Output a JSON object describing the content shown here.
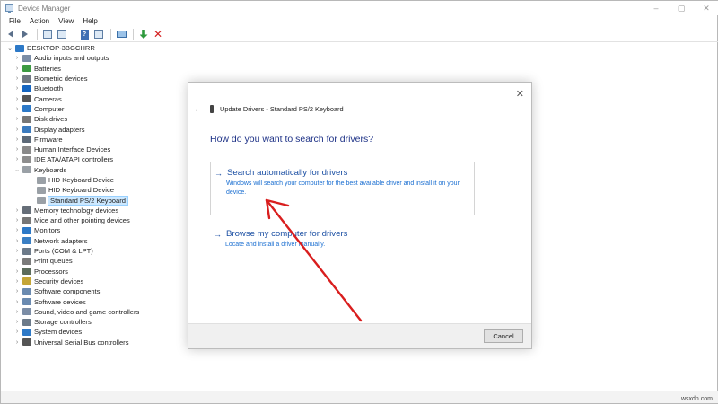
{
  "window": {
    "title": "Device Manager"
  },
  "titlebar": {
    "minimize": "–",
    "restore": "▢",
    "close": "✕"
  },
  "menu": [
    "File",
    "Action",
    "View",
    "Help"
  ],
  "toolbar": {
    "icons": [
      "back-icon",
      "forward-icon",
      "show-hide-tree-icon",
      "properties-icon",
      "help-icon",
      "scan-hardware-icon",
      "update-driver-icon",
      "uninstall-icon"
    ],
    "properties_glyph": "?"
  },
  "tree": {
    "root": "DESKTOP-3BGCHRR",
    "items": [
      {
        "label": "Audio inputs and outputs",
        "color": "#7b8da6",
        "expanded": false
      },
      {
        "label": "Batteries",
        "color": "#3c9a42",
        "expanded": false
      },
      {
        "label": "Biometric devices",
        "color": "#6f7782",
        "expanded": false
      },
      {
        "label": "Bluetooth",
        "color": "#1565c0",
        "expanded": false
      },
      {
        "label": "Cameras",
        "color": "#555555",
        "expanded": false
      },
      {
        "label": "Computer",
        "color": "#2d79c7",
        "expanded": false
      },
      {
        "label": "Disk drives",
        "color": "#777777",
        "expanded": false
      },
      {
        "label": "Display adapters",
        "color": "#3b7bbf",
        "expanded": false
      },
      {
        "label": "Firmware",
        "color": "#5d6a78",
        "expanded": false
      },
      {
        "label": "Human Interface Devices",
        "color": "#8a8a8a",
        "expanded": false
      },
      {
        "label": "IDE ATA/ATAPI controllers",
        "color": "#8e8e8e",
        "expanded": false
      },
      {
        "label": "Keyboards",
        "color": "#9aa0a6",
        "expanded": true
      },
      {
        "label": "HID Keyboard Device",
        "color": "#9aa0a6",
        "child": true
      },
      {
        "label": "HID Keyboard Device",
        "color": "#9aa0a6",
        "child": true
      },
      {
        "label": "Standard PS/2 Keyboard",
        "color": "#9aa0a6",
        "child": true,
        "selected": true
      },
      {
        "label": "Memory technology devices",
        "color": "#666e78",
        "expanded": false
      },
      {
        "label": "Mice and other pointing devices",
        "color": "#777777",
        "expanded": false
      },
      {
        "label": "Monitors",
        "color": "#2d79c7",
        "expanded": false
      },
      {
        "label": "Network adapters",
        "color": "#3a7fc4",
        "expanded": false
      },
      {
        "label": "Ports (COM & LPT)",
        "color": "#6c7a89",
        "expanded": false
      },
      {
        "label": "Print queues",
        "color": "#7a7a7a",
        "expanded": false
      },
      {
        "label": "Processors",
        "color": "#5b6b5b",
        "expanded": false
      },
      {
        "label": "Security devices",
        "color": "#c4a537",
        "expanded": false
      },
      {
        "label": "Software components",
        "color": "#6a8ab0",
        "expanded": false
      },
      {
        "label": "Software devices",
        "color": "#6a8ab0",
        "expanded": false
      },
      {
        "label": "Sound, video and game controllers",
        "color": "#7b8da6",
        "expanded": false
      },
      {
        "label": "Storage controllers",
        "color": "#6c7a89",
        "expanded": false
      },
      {
        "label": "System devices",
        "color": "#2d79c7",
        "expanded": false
      },
      {
        "label": "Universal Serial Bus controllers",
        "color": "#555555",
        "expanded": false
      }
    ]
  },
  "dialog": {
    "close": "✕",
    "back": "←",
    "title": "Update Drivers - Standard PS/2 Keyboard",
    "heading": "How do you want to search for drivers?",
    "options": [
      {
        "arrow": "→",
        "title": "Search automatically for drivers",
        "desc": "Windows will search your computer for the best available driver and install it on your device."
      },
      {
        "arrow": "→",
        "title": "Browse my computer for drivers",
        "desc": "Locate and install a driver manually."
      }
    ],
    "cancel": "Cancel"
  },
  "watermark": "wsxdn.com",
  "colors": {
    "accent": "#1b4fa3",
    "heading": "#1e3287",
    "annotation": "#d91e1e",
    "selection": "#cce8ff"
  }
}
